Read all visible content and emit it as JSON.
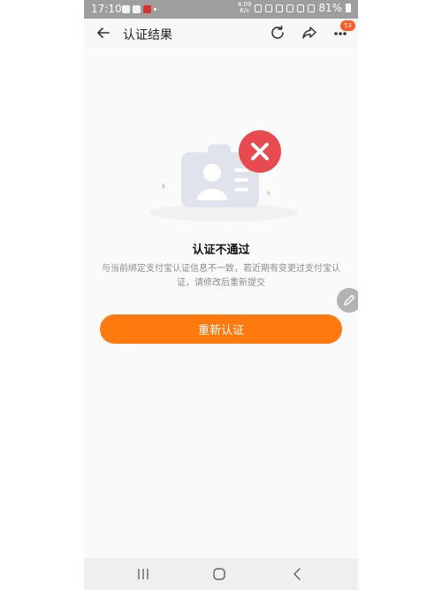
{
  "status_bar": {
    "time": "17:10",
    "net_speed_top": "4.09",
    "net_speed_bottom": "K/s",
    "battery": "81%"
  },
  "nav": {
    "title": "认证结果",
    "badge_count": "53"
  },
  "result": {
    "title": "认证不通过",
    "description": "与当前绑定支付宝认证信息不一致，若近期有变更过支付宝认证，请修改后重新提交"
  },
  "actions": {
    "retry_label": "重新认证"
  },
  "colors": {
    "accent": "#ff7a0e",
    "error": "#e94a4f",
    "badge": "#ff5a1f"
  },
  "icons": [
    "back-arrow-icon",
    "refresh-icon",
    "share-icon",
    "more-icon",
    "error-x-icon",
    "edit-pencil-icon",
    "recent-apps-icon",
    "home-icon",
    "back-nav-icon"
  ]
}
